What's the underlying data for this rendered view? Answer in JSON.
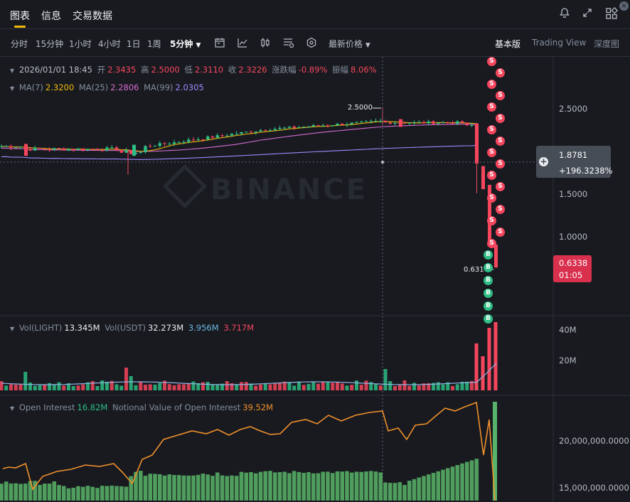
{
  "top_tabs": [
    {
      "label": "图表",
      "active": true
    },
    {
      "label": "信息",
      "active": false
    },
    {
      "label": "交易数据",
      "active": false
    }
  ],
  "top_icons": [
    "bell-icon",
    "expand-icon",
    "layout-grid-icon"
  ],
  "toolbar": {
    "intervals": [
      "分时",
      "15分钟",
      "1小时",
      "4小时",
      "1日",
      "1周"
    ],
    "active_interval": "5分钟",
    "price_type": "最新价格",
    "views": [
      {
        "label": "基本版",
        "active": true
      },
      {
        "label": "Trading View",
        "active": false
      },
      {
        "label": "深度图",
        "active": false
      }
    ]
  },
  "ohlc": {
    "date": "2026/01/01 18:45",
    "open_label": "开",
    "open": "2.3435",
    "high_label": "高",
    "high": "2.5000",
    "low_label": "低",
    "low": "2.3110",
    "close_label": "收",
    "close": "2.3226",
    "change_label": "涨跌幅",
    "change": "-0.89%",
    "amplitude_label": "振幅",
    "amplitude": "8.06%"
  },
  "ma": {
    "ma7_label": "MA(7)",
    "ma7": "2.3200",
    "ma25_label": "MA(25)",
    "ma25": "2.2806",
    "ma99_label": "MA(99)",
    "ma99": "2.0305"
  },
  "price_axis": {
    "ticks": [
      "2.5000",
      "1.5000",
      "1.0000"
    ],
    "crosshair_price": "1.8781",
    "crosshair_change": "+196.3238%",
    "current_price": "0.6338",
    "countdown": "01:05",
    "high_marker": "2.5000",
    "low_marker": "0.6314"
  },
  "watermark": "BINANCE",
  "badges": {
    "sell": "S",
    "buy": "B"
  },
  "volume": {
    "label": "Vol(LIGHT)",
    "value": "13.345M",
    "usdt_label": "Vol(USDT)",
    "usdt_value": "32.273M",
    "v1": "3.956M",
    "v2": "3.717M",
    "ticks": [
      "40M",
      "20M"
    ]
  },
  "open_interest": {
    "label": "Open Interest",
    "value": "16.82M",
    "notional_label": "Notional Value of Open Interest",
    "notional_value": "39.52M",
    "ticks": [
      "20,000,000.0000",
      "15,000,000.0000"
    ]
  },
  "colors": {
    "up": "#2ebd85",
    "down": "#f6465d",
    "accent": "#f0b90b",
    "ma7": "#f0b90b",
    "ma25": "#d56bcf",
    "ma99": "#9b8afb",
    "oi_line": "#f0902b",
    "oi_bar": "#4f9e5d"
  }
}
